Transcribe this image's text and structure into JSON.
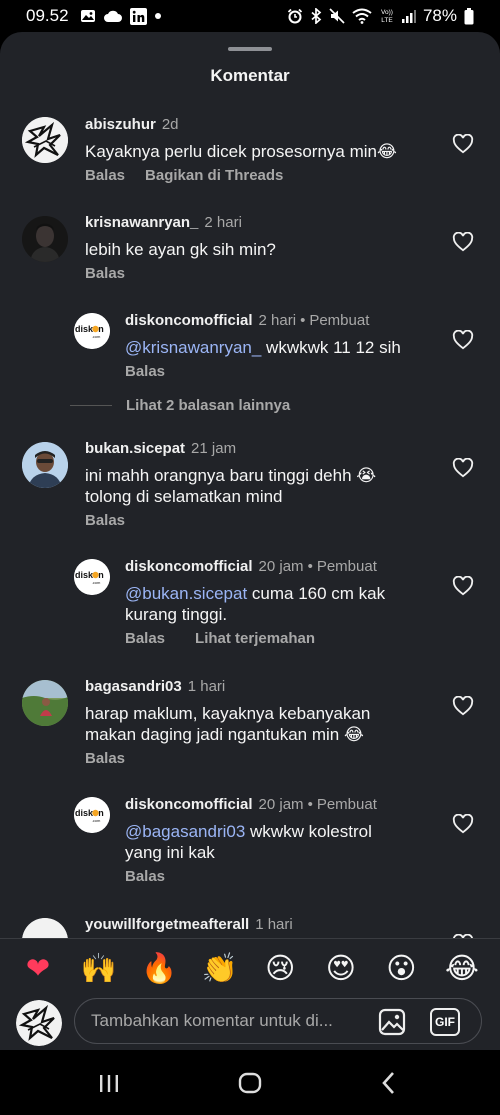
{
  "status_bar": {
    "time": "09.52",
    "battery": "78%",
    "left_icons": [
      "photo-icon",
      "cloud-icon",
      "linkedin-icon",
      "dot-icon"
    ],
    "right_icons": [
      "alarm-icon",
      "bluetooth-icon",
      "mute-icon",
      "wifi-icon",
      "volte-icon",
      "signal-icon",
      "battery-icon"
    ],
    "volte_label": "VoLTE"
  },
  "sheet": {
    "title": "Komentar"
  },
  "comments": [
    {
      "username": "abiszuhur",
      "time": "2d",
      "author_badge": "",
      "text": "Kayaknya perlu dicek prosesornya min😂",
      "actions": [
        "Balas",
        "Bagikan di Threads"
      ]
    },
    {
      "username": "krisnawanryan_",
      "time": "2 hari",
      "author_badge": "",
      "text": "lebih ke ayan gk  sih min?",
      "actions": [
        "Balas"
      ],
      "replies": [
        {
          "username": "diskoncomofficial",
          "time": "2 hari",
          "author_badge": "Pembuat",
          "mention": "@krisnawanryan_",
          "text": " wkwkwk 11 12 sih",
          "actions": [
            "Balas"
          ]
        }
      ],
      "more_replies": "Lihat 2 balasan lainnya"
    },
    {
      "username": "bukan.sicepat",
      "time": "21 jam",
      "author_badge": "",
      "text_lines": [
        "ini mahh orangnya baru tinggi dehh 😭",
        "tolong di selamatkan mind"
      ],
      "actions": [
        "Balas"
      ],
      "replies": [
        {
          "username": "diskoncomofficial",
          "time": "20 jam",
          "author_badge": "Pembuat",
          "mention": "@bukan.sicepat",
          "text_line1": " cuma 160 cm kak",
          "text_line2": "kurang tinggi.",
          "actions": [
            "Balas",
            "Lihat terjemahan"
          ]
        }
      ]
    },
    {
      "username": "bagasandri03",
      "time": "1 hari",
      "author_badge": "",
      "text_lines": [
        "harap maklum, kayaknya kebanyakan",
        "makan daging jadi ngantukan min 😂"
      ],
      "actions": [
        "Balas"
      ],
      "replies": [
        {
          "username": "diskoncomofficial",
          "time": "20 jam",
          "author_badge": "Pembuat",
          "mention": "@bagasandri03",
          "text_line1": " wkwkw kolestrol",
          "text_line2": "yang ini kak",
          "actions": [
            "Balas"
          ]
        }
      ]
    },
    {
      "username": "youwillforgetmeafterall",
      "time": "1 hari",
      "author_badge": ""
    }
  ],
  "brand": {
    "reply_avatar_text": "disk",
    "reply_avatar_text2": "n",
    "reply_avatar_sub": ".com"
  },
  "emoji_bar": [
    "❤",
    "🙌",
    "🔥",
    "👏",
    "😢",
    "😍",
    "😮",
    "😂"
  ],
  "comment_input": {
    "placeholder": "Tambahkan komentar untuk di...",
    "gif_label": "GIF"
  },
  "nav_bar": {
    "buttons": [
      "recent-apps-icon",
      "home-icon",
      "back-icon"
    ]
  },
  "colors": {
    "sheet_bg": "#212328",
    "mention": "#9bb5f5",
    "secondary_text": "#a8a8a8"
  }
}
